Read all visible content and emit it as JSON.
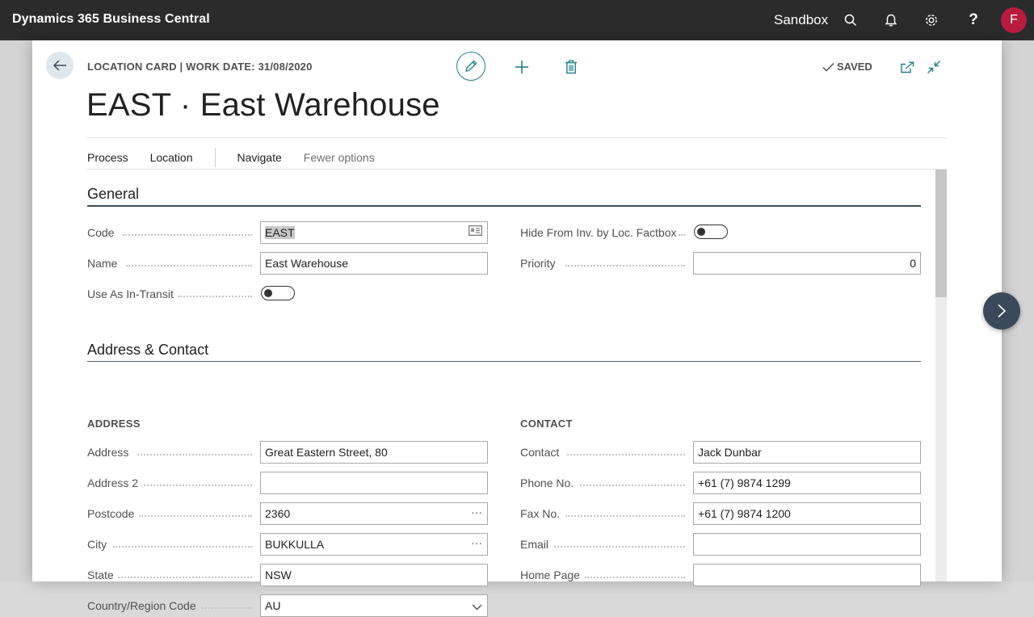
{
  "app": {
    "title": "Dynamics 365 Business Central",
    "environment": "Sandbox",
    "user_initial": "F",
    "icons": [
      "search-icon",
      "bell-icon",
      "gear-icon",
      "help-icon"
    ]
  },
  "page": {
    "caption": "LOCATION CARD | WORK DATE: 31/08/2020",
    "title": "EAST · East Warehouse",
    "status": "SAVED"
  },
  "menu": {
    "process": "Process",
    "location": "Location",
    "navigate": "Navigate",
    "fewer_options": "Fewer options"
  },
  "general": {
    "title": "General",
    "code_label": "Code",
    "code_value": "EAST",
    "name_label": "Name",
    "name_value": "East Warehouse",
    "in_transit_label": "Use As In-Transit",
    "in_transit_on": false,
    "hide_label": "Hide From Inv. by Loc. Factbox",
    "hide_on": false,
    "priority_label": "Priority",
    "priority_value": "0"
  },
  "address_contact": {
    "title": "Address & Contact",
    "address_heading": "ADDRESS",
    "contact_heading": "CONTACT",
    "address_label": "Address",
    "address_value": "Great Eastern Street, 80",
    "address2_label": "Address 2",
    "address2_value": "",
    "postcode_label": "Postcode",
    "postcode_value": "2360",
    "city_label": "City",
    "city_value": "BUKKULLA",
    "state_label": "State",
    "state_value": "NSW",
    "country_label": "Country/Region Code",
    "country_value": "AU",
    "contact_label": "Contact",
    "contact_value": "Jack Dunbar",
    "phone_label": "Phone No.",
    "phone_value": "+61 (7) 9874 1299",
    "fax_label": "Fax No.",
    "fax_value": "+61 (7) 9874 1200",
    "email_label": "Email",
    "email_value": "",
    "homepage_label": "Home Page",
    "homepage_value": ""
  },
  "colors": {
    "topbar": "#2b2b2b",
    "accent": "#1d7e8c",
    "avatar": "#b71c3f",
    "section_rule": "#3a4a5a"
  }
}
